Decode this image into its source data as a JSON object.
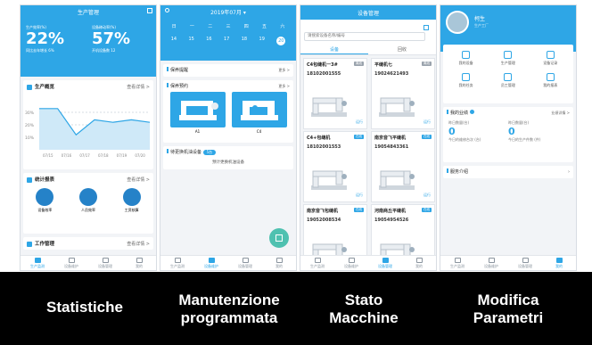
{
  "colors": {
    "accent": "#2ea6e6",
    "tag_gray": "#9aa3ad",
    "tag_blue": "#2ea6e6",
    "fab": "#4fc1b0"
  },
  "tabbar": [
    {
      "label": "生产监测",
      "icon": "factory-icon"
    },
    {
      "label": "设备维护",
      "icon": "gear-icon"
    },
    {
      "label": "设备管理",
      "icon": "monitor-icon"
    },
    {
      "label": "我的",
      "icon": "user-icon"
    }
  ],
  "p1": {
    "title": "生产管理",
    "stat1": {
      "label": "生产效率(%)",
      "value": "22%",
      "sub": "同比去年增长 6%"
    },
    "stat2": {
      "label": "设备稼动率(%)",
      "value": "57%",
      "sub": "开机设备数 12"
    },
    "overview": {
      "title": "生产概览",
      "more": "查看详情 >"
    },
    "chart_data": {
      "type": "line",
      "x": [
        "07/15",
        "07/16",
        "07/17",
        "07/18",
        "07/19",
        "07/20"
      ],
      "yticks": [
        "30%",
        "20%",
        "10%"
      ],
      "series": [
        {
          "values": [
            33,
            33,
            12,
            24,
            22,
            24,
            22
          ]
        }
      ],
      "ylim": [
        0,
        40
      ]
    },
    "stats": {
      "title": "统计报表",
      "more": "查看详情 >",
      "items": [
        "设备效率",
        "人员效率",
        "工资核算"
      ]
    },
    "work": {
      "title": "工作管理",
      "more": "查看详情 >"
    }
  },
  "p2": {
    "month": "2019年07月",
    "weekdays": [
      "日",
      "一",
      "二",
      "三",
      "四",
      "五",
      "六"
    ],
    "dates": [
      "14",
      "15",
      "16",
      "17",
      "18",
      "19",
      "20"
    ],
    "plan": {
      "title": "保养提醒",
      "more": "更多 >"
    },
    "done": {
      "title": "保养预约",
      "more": "更多 >"
    },
    "machines": [
      "A1",
      "C4"
    ],
    "upcoming": {
      "label": "待更换机油设备",
      "badge": "5台"
    },
    "link": "预计更换机油设备"
  },
  "p3": {
    "title": "设备管理",
    "search_placeholder": "请搜索设备名称/编号",
    "tabs": [
      "设备",
      "回收"
    ],
    "devices": [
      {
        "name": "C4包缝机一3#",
        "tag": "离线",
        "tagcolor": "#9aa3ad",
        "code": "18102001555",
        "status": "运行"
      },
      {
        "name": "平缝机七",
        "tag": "离线",
        "tagcolor": "#9aa3ad",
        "code": "19024621493",
        "status": "运行"
      },
      {
        "name": "C4+包缝机",
        "tag": "在线",
        "tagcolor": "#2ea6e6",
        "code": "18102001553",
        "status": "运行"
      },
      {
        "name": "南京音飞平缝机",
        "tag": "在线",
        "tagcolor": "#2ea6e6",
        "code": "19054843361",
        "status": "运行"
      },
      {
        "name": "南京音飞包缝机",
        "tag": "在线",
        "tagcolor": "#2ea6e6",
        "code": "19052008534",
        "status": "运行"
      },
      {
        "name": "河南商丘平缝机",
        "tag": "在线",
        "tagcolor": "#2ea6e6",
        "code": "19054954526",
        "status": "运行"
      }
    ]
  },
  "p4": {
    "name": "柯生",
    "role": "生产工厂",
    "menu": [
      "我的设备",
      "生产管理",
      "设备记录",
      "我的任务",
      "员工管理",
      "我的报表"
    ],
    "menu_icons": [
      "device-icon",
      "printer-icon",
      "fan-icon",
      "task-icon",
      "staff-icon",
      "report-icon"
    ],
    "perf": {
      "title": "我的业绩",
      "more": "业绩详情 >"
    },
    "kpi1": {
      "label": "昨日数量(台)",
      "value": "0",
      "sub": "今日的维修台次 (台)"
    },
    "kpi2": {
      "label": "昨日数量(台)",
      "value": "0",
      "sub": "今日的生产件数 (件)"
    },
    "about": "服务介绍"
  },
  "captions": [
    "Statistiche",
    "Manutenzione programmata",
    "Stato Macchine",
    "Modifica Parametri"
  ]
}
